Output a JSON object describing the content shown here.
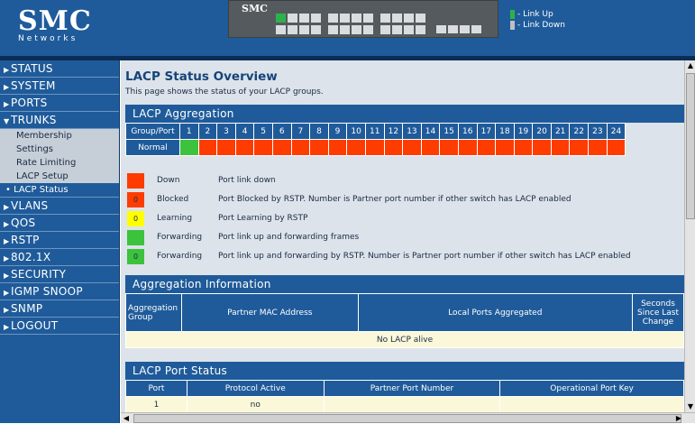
{
  "brand": {
    "logo": "SMC",
    "tagline": "Networks",
    "device_brand": "SMC"
  },
  "header_legend": {
    "link_up": "- Link Up",
    "link_down": "- Link Down",
    "link_up_color": "#2db24a",
    "link_down_color": "#c0c0c0"
  },
  "sidebar": {
    "items": [
      {
        "label": "STATUS",
        "expanded": false
      },
      {
        "label": "SYSTEM",
        "expanded": false
      },
      {
        "label": "PORTS",
        "expanded": false
      },
      {
        "label": "TRUNKS",
        "expanded": true
      },
      {
        "label": "VLANS",
        "expanded": false
      },
      {
        "label": "QOS",
        "expanded": false
      },
      {
        "label": "RSTP",
        "expanded": false
      },
      {
        "label": "802.1X",
        "expanded": false
      },
      {
        "label": "SECURITY",
        "expanded": false
      },
      {
        "label": "IGMP SNOOP",
        "expanded": false
      },
      {
        "label": "SNMP",
        "expanded": false
      },
      {
        "label": "LOGOUT",
        "expanded": false
      }
    ],
    "trunks_sub": [
      "Membership",
      "Settings",
      "Rate Limiting",
      "LACP Setup",
      "• LACP Status"
    ]
  },
  "page": {
    "title": "LACP Status Overview",
    "description": "This page shows the status of your LACP groups."
  },
  "aggregation": {
    "heading": "LACP Aggregation",
    "group_port_label": "Group/Port",
    "row_label": "Normal",
    "ports": [
      "1",
      "2",
      "3",
      "4",
      "5",
      "6",
      "7",
      "8",
      "9",
      "10",
      "11",
      "12",
      "13",
      "14",
      "15",
      "16",
      "17",
      "18",
      "19",
      "20",
      "21",
      "22",
      "23",
      "24"
    ],
    "port_states": [
      "up",
      "down",
      "down",
      "down",
      "down",
      "down",
      "down",
      "down",
      "down",
      "down",
      "down",
      "down",
      "down",
      "down",
      "down",
      "down",
      "down",
      "down",
      "down",
      "down",
      "down",
      "down",
      "down",
      "down"
    ]
  },
  "legend": [
    {
      "swatch_color": "#ff3c00",
      "swatch_text": "",
      "name": "Down",
      "desc": "Port link down"
    },
    {
      "swatch_color": "#ff3c00",
      "swatch_text": "0",
      "name": "Blocked",
      "desc": "Port Blocked by RSTP. Number is Partner port number if other switch has LACP enabled"
    },
    {
      "swatch_color": "#ffff00",
      "swatch_text": "0",
      "name": "Learning",
      "desc": "Port Learning by RSTP"
    },
    {
      "swatch_color": "#3cc23c",
      "swatch_text": "",
      "name": "Forwarding",
      "desc": "Port link up and forwarding frames"
    },
    {
      "swatch_color": "#3cc23c",
      "swatch_text": "0",
      "name": "Forwarding",
      "desc": "Port link up and forwarding by RSTP. Number is Partner port number if other switch has LACP enabled"
    }
  ],
  "aggregation_info": {
    "heading": "Aggregation Information",
    "columns": [
      "Aggregation Group",
      "Partner MAC Address",
      "Local Ports Aggregated",
      "Seconds Since Last Change"
    ],
    "empty_message": "No LACP alive"
  },
  "port_status": {
    "heading": "LACP Port Status",
    "columns": [
      "Port",
      "Protocol Active",
      "Partner Port Number",
      "Operational Port Key"
    ],
    "rows": [
      [
        "1",
        "no",
        "",
        ""
      ]
    ]
  }
}
